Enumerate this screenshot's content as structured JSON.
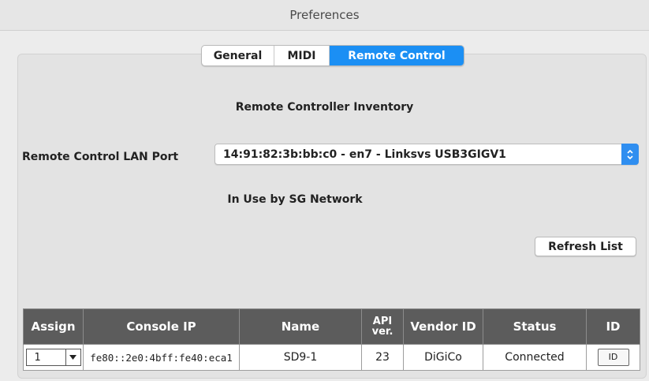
{
  "window": {
    "title": "Preferences"
  },
  "tabs": [
    {
      "label": "General"
    },
    {
      "label": "MIDI"
    },
    {
      "label": "Remote Control",
      "selected": true
    }
  ],
  "remote": {
    "heading": "Remote Controller Inventory",
    "port_label": "Remote Control LAN Port",
    "port_value": "14:91:82:3b:bb:c0 - en7 - Linksvs USB3GIGV1",
    "status_text": "In Use by SG Network",
    "refresh_label": "Refresh List"
  },
  "table": {
    "headers": {
      "assign": "Assign",
      "console_ip": "Console IP",
      "name": "Name",
      "api_line1": "API",
      "api_line2": "ver.",
      "vendor_id": "Vendor ID",
      "status": "Status",
      "id": "ID"
    },
    "rows": [
      {
        "assign": "1",
        "console_ip": "fe80::2e0:4bff:fe40:eca1",
        "name": "SD9-1",
        "api_ver": "23",
        "vendor_id": "DiGiCo",
        "status": "Connected",
        "id_button": "ID"
      }
    ]
  },
  "colors": {
    "accent": "#1b8ff4",
    "table_header_bg": "#5c5c5c",
    "window_bg": "#ececec"
  },
  "icons": {
    "port_dropdown": "chevron-up-down-icon",
    "assign_dropdown": "triangle-down-icon"
  }
}
